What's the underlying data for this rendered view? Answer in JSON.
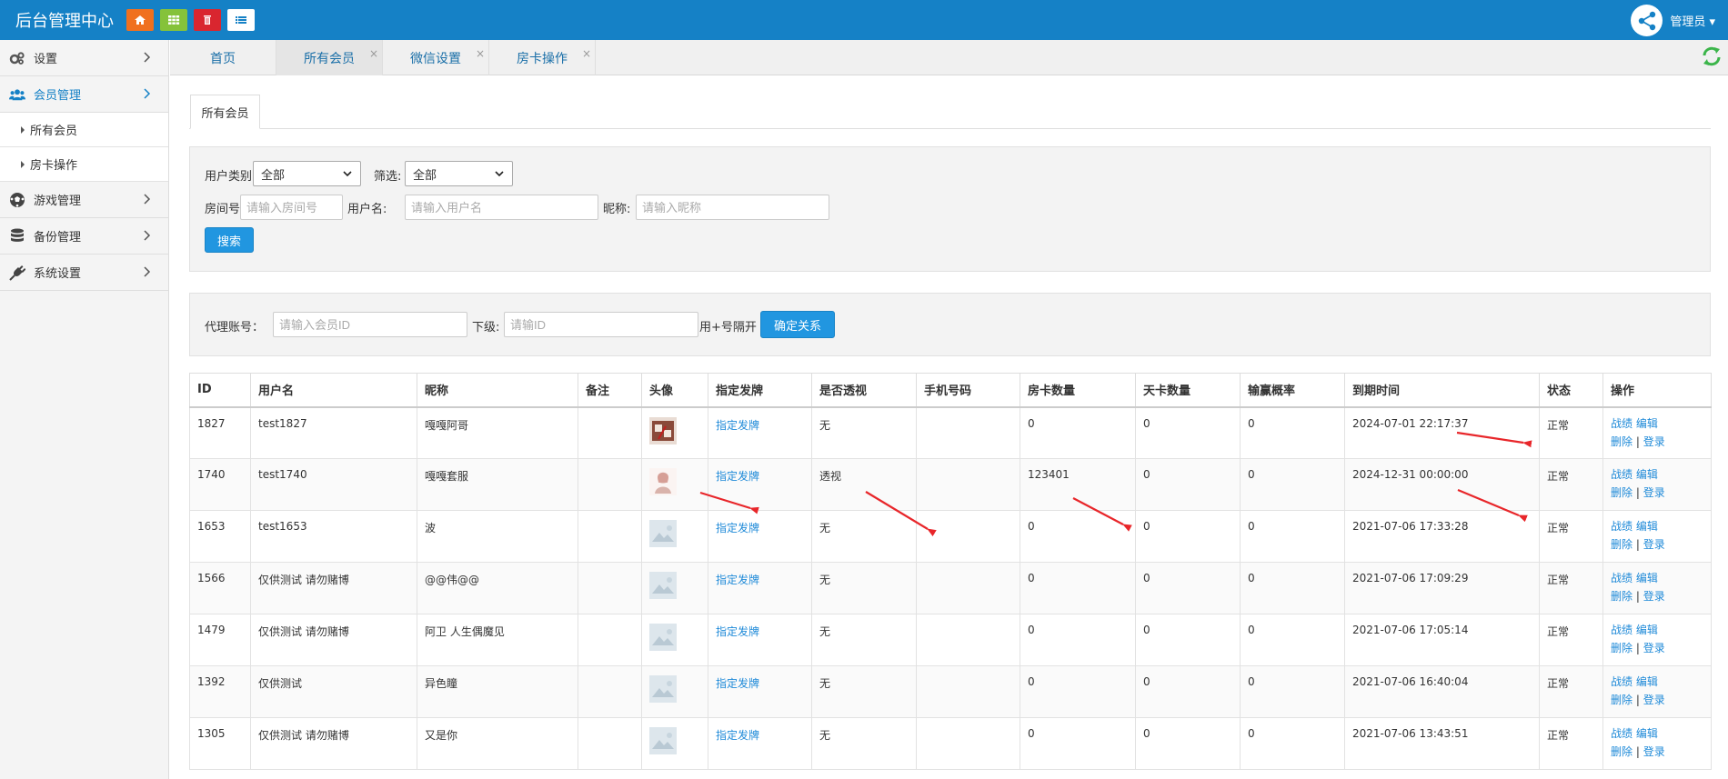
{
  "app": {
    "title": "后台管理中心",
    "quick_buttons": [
      {
        "name": "home",
        "icon": "home-icon",
        "color": "#f0701f"
      },
      {
        "name": "grid",
        "icon": "grid-icon",
        "color": "#85c23a"
      },
      {
        "name": "delete",
        "icon": "trash-icon",
        "color": "#d9262f"
      },
      {
        "name": "list",
        "icon": "list-icon",
        "color": "#ffffff"
      }
    ],
    "user": {
      "name": "管理员 ▾",
      "avatar_icon": "share-network-icon"
    }
  },
  "sidebar": {
    "menu": [
      {
        "label": "设置",
        "icon": "gears-icon",
        "active": false
      },
      {
        "label": "会员管理",
        "icon": "users-icon",
        "active": true
      },
      {
        "label": "游戏管理",
        "icon": "soccer-ball-icon",
        "active": false
      },
      {
        "label": "备份管理",
        "icon": "database-icon",
        "active": false
      },
      {
        "label": "系统设置",
        "icon": "plug-icon",
        "active": false
      }
    ],
    "submenu": [
      {
        "label": "所有会员"
      },
      {
        "label": "房卡操作"
      }
    ]
  },
  "tabs": [
    {
      "label": "首页",
      "closable": false,
      "active": false
    },
    {
      "label": "所有会员",
      "closable": true,
      "active": true
    },
    {
      "label": "微信设置",
      "closable": true,
      "active": false
    },
    {
      "label": "房卡操作",
      "closable": true,
      "active": false
    }
  ],
  "tab_close_glyph": "×",
  "page_tab": "所有会员",
  "filters": {
    "user_type_label": "用户类别:",
    "user_type_value": "全部",
    "filter_label": "筛选:",
    "filter_value": "全部",
    "room_label": "房间号:",
    "room_placeholder": "请输入房间号",
    "username_label": "用户名:",
    "username_placeholder": "请输入用户名",
    "nickname_label": "昵称:",
    "nickname_placeholder": "请输入昵称",
    "search_button": "搜索"
  },
  "agent": {
    "account_label": "代理账号：",
    "account_placeholder": "请输入会员ID",
    "sub_label": "下级:",
    "sub_placeholder": "请输ID",
    "hint": "用+号隔开",
    "confirm_button": "确定关系"
  },
  "table": {
    "headers": [
      "ID",
      "用户名",
      "昵称",
      "备注",
      "头像",
      "指定发牌",
      "是否透视",
      "手机号码",
      "房卡数量",
      "天卡数量",
      "输赢概率",
      "到期时间",
      "状态",
      "操作"
    ],
    "deal_link": "指定发牌",
    "ops": {
      "stats": "战绩",
      "edit": "编辑",
      "delete": "删除",
      "sep": "|",
      "login": "登录"
    },
    "rows": [
      {
        "id": "1827",
        "username": "test1827",
        "nickname": "嘎嘎阿哥",
        "remark": "",
        "avatar": "photo",
        "transparent": "无",
        "phone": "",
        "room_cards": "0",
        "day_cards": "0",
        "win_rate": "0",
        "expire": "2024-07-01 22:17:37",
        "status": "正常"
      },
      {
        "id": "1740",
        "username": "test1740",
        "nickname": "嘎嘎套服",
        "remark": "",
        "avatar": "portrait",
        "transparent": "透视",
        "phone": "",
        "room_cards": "123401",
        "day_cards": "0",
        "win_rate": "0",
        "expire": "2024-12-31 00:00:00",
        "status": "正常"
      },
      {
        "id": "1653",
        "username": "test1653",
        "nickname": "波",
        "remark": "",
        "avatar": "placeholder",
        "transparent": "无",
        "phone": "",
        "room_cards": "0",
        "day_cards": "0",
        "win_rate": "0",
        "expire": "2021-07-06 17:33:28",
        "status": "正常"
      },
      {
        "id": "1566",
        "username": "仅供测试 请勿赌博",
        "nickname": "@@伟@@",
        "remark": "",
        "avatar": "placeholder",
        "transparent": "无",
        "phone": "",
        "room_cards": "0",
        "day_cards": "0",
        "win_rate": "0",
        "expire": "2021-07-06 17:09:29",
        "status": "正常"
      },
      {
        "id": "1479",
        "username": "仅供测试 请勿赌博",
        "nickname": "阿卫 人生偶魔见",
        "remark": "",
        "avatar": "placeholder",
        "transparent": "无",
        "phone": "",
        "room_cards": "0",
        "day_cards": "0",
        "win_rate": "0",
        "expire": "2021-07-06 17:05:14",
        "status": "正常"
      },
      {
        "id": "1392",
        "username": "仅供测试",
        "nickname": "异色瞳",
        "remark": "",
        "avatar": "placeholder",
        "transparent": "无",
        "phone": "",
        "room_cards": "0",
        "day_cards": "0",
        "win_rate": "0",
        "expire": "2021-07-06 16:40:04",
        "status": "正常"
      },
      {
        "id": "1305",
        "username": "仅供测试 请勿赌博",
        "nickname": "又是你",
        "remark": "",
        "avatar": "placeholder",
        "transparent": "无",
        "phone": "",
        "room_cards": "0",
        "day_cards": "0",
        "win_rate": "0",
        "expire": "2021-07-06 13:43:51",
        "status": "正常"
      }
    ]
  },
  "colors": {
    "header": "#1581c6",
    "link": "#1f8ad8",
    "button": "#2196e0",
    "annotation_arrow": "#e8262a",
    "refresh": "#3bb54a"
  }
}
